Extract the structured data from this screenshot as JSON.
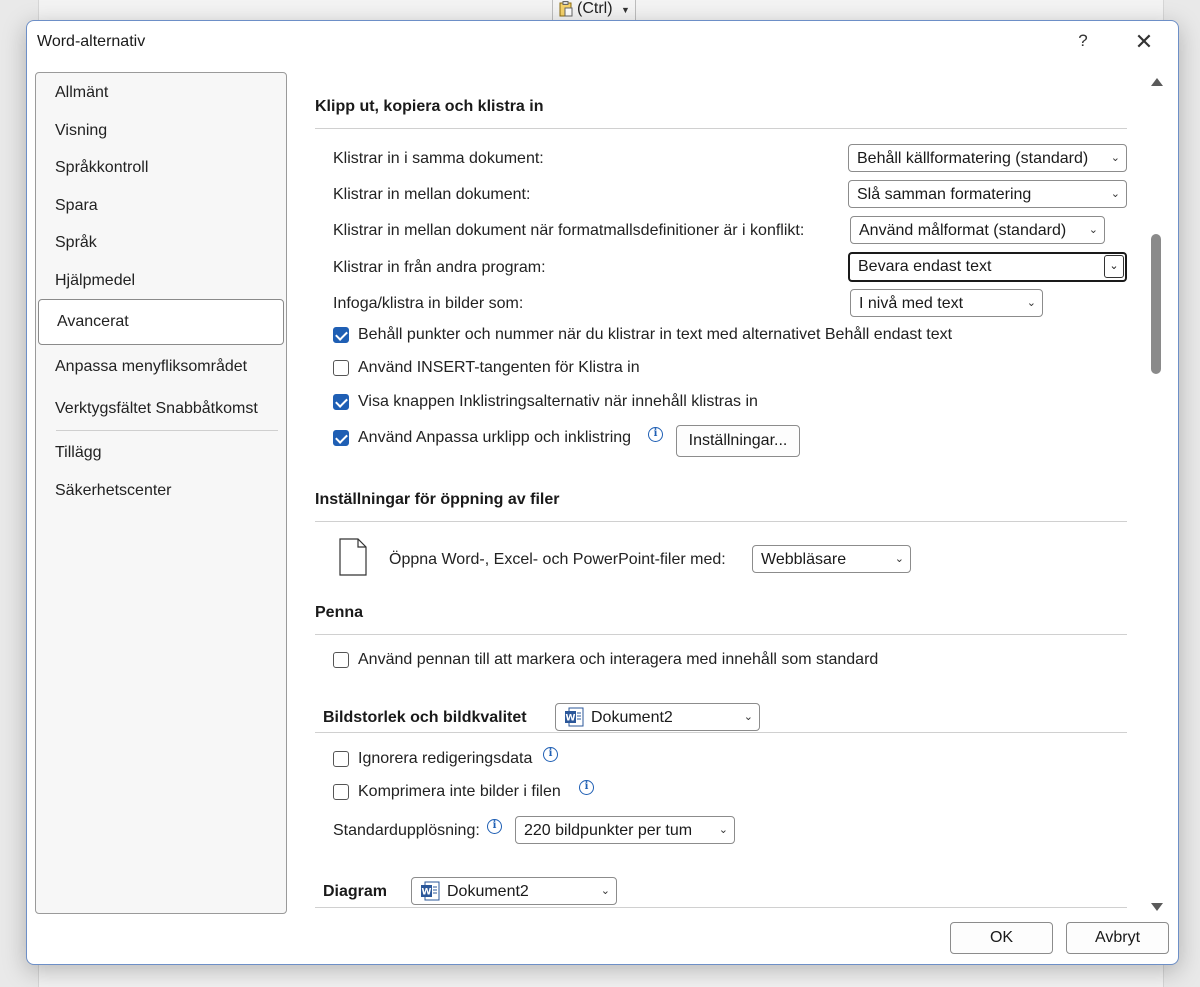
{
  "background": {
    "paste_chip_label": "(Ctrl)"
  },
  "dialog": {
    "title": "Word-alternativ",
    "help": "?",
    "close": "✕"
  },
  "nav": {
    "items": [
      {
        "label": "Allmänt"
      },
      {
        "label": "Visning"
      },
      {
        "label": "Språkkontroll"
      },
      {
        "label": "Spara"
      },
      {
        "label": "Språk"
      },
      {
        "label": "Hjälpmedel"
      },
      {
        "label": "Avancerat"
      },
      {
        "label": "Anpassa menyfliksområdet"
      },
      {
        "label": "Verktygsfältet Snabbåtkomst"
      },
      {
        "label": "Tillägg"
      },
      {
        "label": "Säkerhetscenter"
      }
    ],
    "active": "Avancerat"
  },
  "sections": {
    "paste": {
      "heading": "Klipp ut, kopiera och klistra in",
      "rows": [
        {
          "label": "Klistrar in i samma dokument:",
          "value": "Behåll källformatering (standard)"
        },
        {
          "label": "Klistrar in mellan dokument:",
          "value": "Slå samman formatering"
        },
        {
          "label": "Klistrar in mellan dokument när formatmallsdefinitioner är i konflikt:",
          "value": "Använd målformat (standard)"
        },
        {
          "label": "Klistrar in från andra program:",
          "value": "Bevara endast text"
        },
        {
          "label": "Infoga/klistra in bilder som:",
          "value": "I nivå med text"
        }
      ],
      "checks": [
        {
          "label": "Behåll punkter och nummer när du klistrar in text med alternativet Behåll endast text",
          "checked": true
        },
        {
          "label": "Använd INSERT-tangenten för Klistra in",
          "checked": false
        },
        {
          "label": "Visa knappen Inklistringsalternativ när innehåll klistras in",
          "checked": true
        },
        {
          "label": "Använd Anpassa urklipp och inklistring",
          "checked": true
        }
      ],
      "settings_button": "Inställningar..."
    },
    "open": {
      "heading": "Inställningar för öppning av filer",
      "label": "Öppna Word-, Excel- och PowerPoint-filer med:",
      "value": "Webbläsare"
    },
    "pen": {
      "heading": "Penna",
      "check": {
        "label": "Använd pennan till att markera och interagera med innehåll som standard",
        "checked": false
      }
    },
    "image": {
      "heading": "Bildstorlek och bildkvalitet",
      "doc": "Dokument2",
      "checks": [
        {
          "label": "Ignorera redigeringsdata",
          "checked": false
        },
        {
          "label": "Komprimera inte bilder i filen",
          "checked": false
        }
      ],
      "resolution_label": "Standardupplösning:",
      "resolution_value": "220 bildpunkter per tum"
    },
    "chart": {
      "heading": "Diagram",
      "doc": "Dokument2"
    }
  },
  "footer": {
    "ok": "OK",
    "cancel": "Avbryt"
  },
  "colors": {
    "accent": "#1f5fb4",
    "dialog_border": "#6d8fc7"
  }
}
